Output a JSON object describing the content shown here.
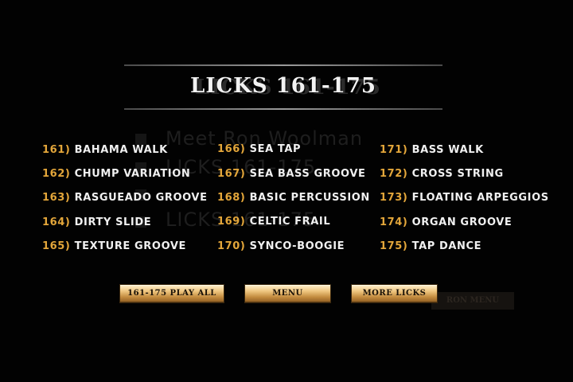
{
  "title": "LICKS 161-175",
  "ghost": {
    "line1": "Meet Ron Woolman",
    "line2": "LICKS 161-175",
    "line3": "LICKS 161-175",
    "button": "RON MENU"
  },
  "licks": {
    "col1": [
      {
        "num": "161)",
        "name": "BAHAMA WALK"
      },
      {
        "num": "162)",
        "name": "CHUMP VARIATION"
      },
      {
        "num": "163)",
        "name": "RASGUEADO GROOVE"
      },
      {
        "num": "164)",
        "name": "DIRTY SLIDE"
      },
      {
        "num": "165)",
        "name": "TEXTURE GROOVE"
      }
    ],
    "col2": [
      {
        "num": "166)",
        "name": "SEA TAP"
      },
      {
        "num": "167)",
        "name": "SEA BASS GROOVE"
      },
      {
        "num": "168)",
        "name": "BASIC PERCUSSION"
      },
      {
        "num": "169)",
        "name": "CELTIC FRAIL"
      },
      {
        "num": "170)",
        "name": "SYNCO-BOOGIE"
      }
    ],
    "col3": [
      {
        "num": "171)",
        "name": "BASS WALK"
      },
      {
        "num": "172)",
        "name": "CROSS STRING"
      },
      {
        "num": "173)",
        "name": "FLOATING ARPEGGIOS"
      },
      {
        "num": "174)",
        "name": "ORGAN GROOVE"
      },
      {
        "num": "175)",
        "name": "TAP DANCE"
      }
    ]
  },
  "buttons": {
    "play_all": "161-175 PLAY ALL",
    "menu": "MENU",
    "more_licks": "MORE LICKS"
  },
  "colors": {
    "background": "#000000",
    "number": "#e3a63a",
    "text": "#f0f0f0",
    "button_gold": "#d9a55a"
  }
}
